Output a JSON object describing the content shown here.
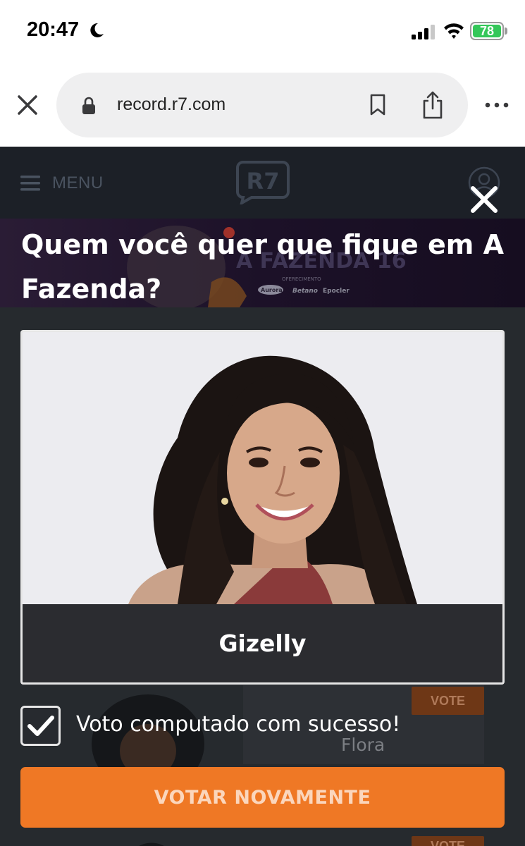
{
  "status_bar": {
    "time": "20:47",
    "battery": "78",
    "icons": [
      "moon-icon",
      "signal-icon",
      "wifi-icon",
      "battery-icon"
    ]
  },
  "browser": {
    "url": "record.r7.com",
    "icons": [
      "close-icon",
      "lock-icon",
      "bookmark-icon",
      "share-icon",
      "more-icon"
    ]
  },
  "site_header": {
    "menu_label": "MENU",
    "logo_text": "R7"
  },
  "banner": {
    "show_title": "A FAZENDA 16",
    "sponsors_label": "OFERECIMENTO",
    "sponsors": [
      "Aurora",
      "Betano",
      "Epocler"
    ]
  },
  "modal": {
    "title": "Quem você quer que fique em A Fazenda?",
    "candidate_name": "Gizelly",
    "success_message": "Voto computado com sucesso!",
    "vote_again_label": "VOTAR NOVAMENTE"
  },
  "background_list": {
    "vote_label": "VOTE",
    "next_candidate": "Flora"
  },
  "colors": {
    "accent": "#ef7825",
    "overlay_bg": "#262a2e",
    "battery_green": "#34c759"
  }
}
